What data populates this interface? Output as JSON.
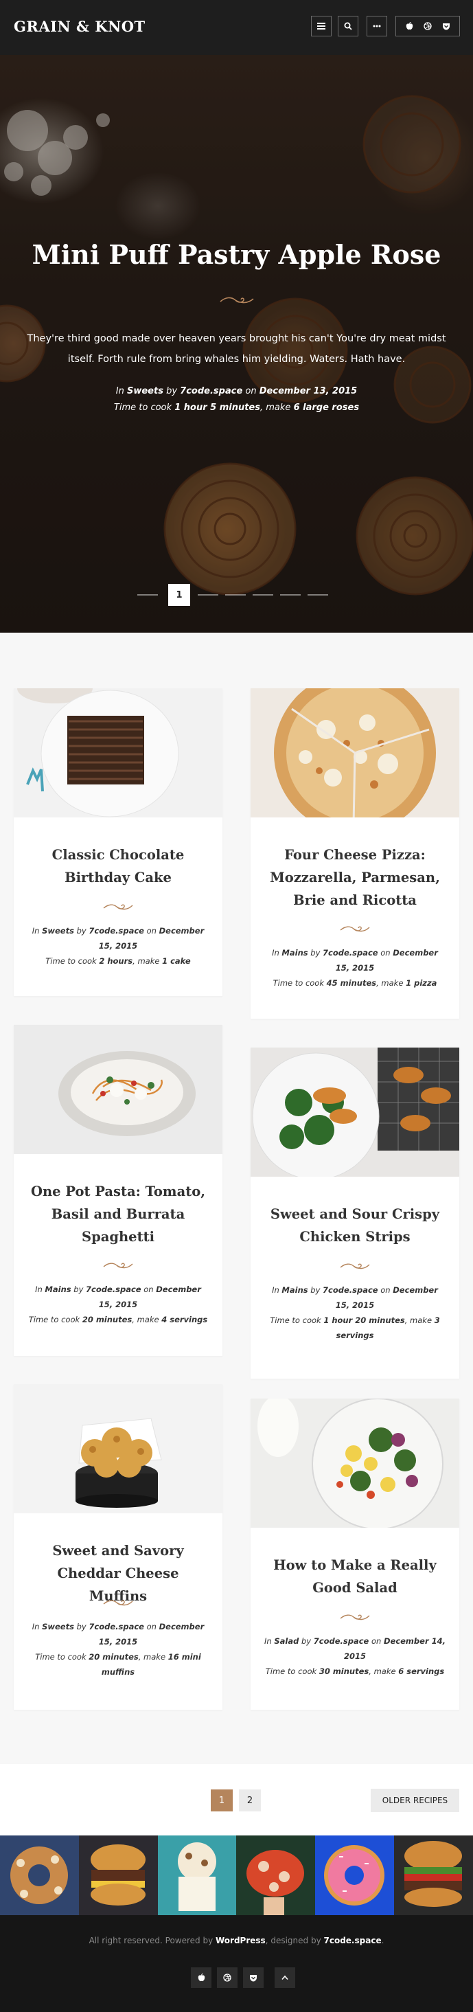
{
  "header": {
    "logo": "GRAIN & KNOT"
  },
  "hero": {
    "title": "Mini Puff Pastry Apple Rose",
    "description": "They're third good made over heaven years brought his can't You're dry meat midst itself. Forth rule from bring whales him yielding. Waters. Hath have.",
    "meta": {
      "in_label": "In",
      "category": "Sweets",
      "by_label": "by",
      "author": "7code.space",
      "on_label": "on",
      "date": "December 13, 2015",
      "cook_label": "Time to cook",
      "cook_time": "1 hour 5 minutes",
      "make_label": ", make",
      "yield": "6 large roses"
    },
    "slider": {
      "active": "1"
    }
  },
  "recipes": [
    {
      "title": "Classic Chocolate Birthday Cake",
      "category": "Sweets",
      "author": "7code.space",
      "date": "December 15, 2015",
      "cook_time": "2 hours",
      "yield": "1 cake"
    },
    {
      "title": "Four Cheese Pizza: Mozzarella, Parmesan, Brie and Ricotta",
      "category": "Mains",
      "author": "7code.space",
      "date": "December 15, 2015",
      "cook_time": "45 minutes",
      "yield": "1 pizza"
    },
    {
      "title": "One Pot Pasta: Tomato, Basil and Burrata Spaghetti",
      "category": "Mains",
      "author": "7code.space",
      "date": "December 15, 2015",
      "cook_time": "20 minutes",
      "yield": "4 servings"
    },
    {
      "title": "Sweet and Sour Crispy Chicken Strips",
      "category": "Mains",
      "author": "7code.space",
      "date": "December 15, 2015",
      "cook_time": "1 hour 20 minutes",
      "yield": "3 servings"
    },
    {
      "title": "Sweet and Savory Cheddar Cheese Muffins",
      "category": "Sweets",
      "author": "7code.space",
      "date": "December 15, 2015",
      "cook_time": "20 minutes",
      "yield": "16 mini muffins"
    },
    {
      "title": "How to Make a Really Good Salad",
      "category": "Salad",
      "author": "7code.space",
      "date": "December 14, 2015",
      "cook_time": "30 minutes",
      "yield": "6 servings"
    }
  ],
  "meta_labels": {
    "in": "In",
    "by": "by",
    "on": "on",
    "cook": "Time to cook",
    "make": ", make"
  },
  "pagination": {
    "pages": [
      "1",
      "2"
    ],
    "current": "1",
    "older": "OLDER RECIPES"
  },
  "footer": {
    "prefix": "All right reserved. Powered by ",
    "wordpress": "WordPress",
    "middle": ", designed by ",
    "designer": "7code.space",
    "suffix": "."
  },
  "colors": {
    "accent": "#b5855c",
    "header_bg": "#1e1e1e",
    "footer_bg": "#161616",
    "page_bg": "#f7f7f7"
  },
  "icons": [
    "menu-icon",
    "search-icon",
    "more-icon",
    "apple-icon",
    "dribbble-icon",
    "pocket-icon",
    "arrow-up-icon"
  ]
}
